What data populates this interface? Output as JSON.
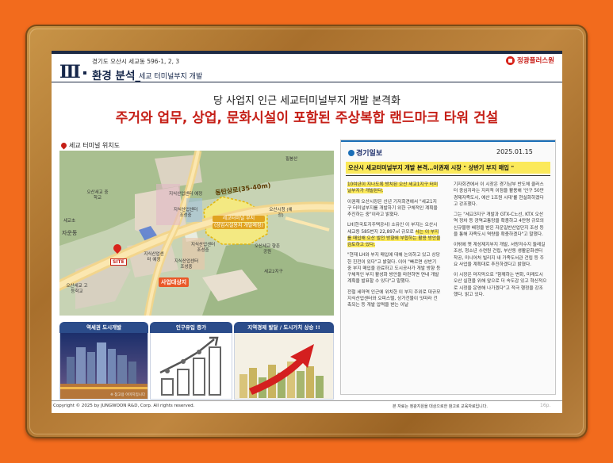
{
  "header": {
    "section_number": "Ⅲ",
    "subtitle": "경기도 오산시 세교동 596-1, 2, 3",
    "title_main": "환경 분석_",
    "title_sub": "세교 터미널부지 개발",
    "brand": "정광플러스원",
    "colors": {
      "navy": "#16274a",
      "red": "#c51f17",
      "frame": "#a86f2c",
      "background": "#f26b1d"
    }
  },
  "headline": {
    "line1": "당 사업지 인근 세교터미널부지 개발 본격화",
    "line2": "주거와 업무, 상업, 문화시설이 포함된 주상복합 랜드마크 타워 건설"
  },
  "map": {
    "label": "세교 터미널 위치도",
    "road_label": "동탄상로(35-40m)",
    "site_label": "SITE",
    "business_label": "사업대상지",
    "terminal_label_1": "세교터미널 부지",
    "terminal_label_2": "(상업시설용지 개발예정)",
    "place_labels": [
      "지식산업센터 예정",
      "지식산업센터 조성중",
      "지식산업센터 조성중",
      "지식산업센터 조성중",
      "지식산업센터 예정",
      "자운동",
      "오산세교 중학교",
      "세교초",
      "오산세교 고등학교",
      "오산시청 (예정)",
      "오산세교 향촌공원",
      "세교2지구",
      "필봉산"
    ]
  },
  "panels": [
    {
      "title": "역세권 도시개발",
      "caption": "※ 참고용 이미지입니다"
    },
    {
      "title": "인구유입 증가"
    },
    {
      "title": "지역경제 발달 / 도시가치 상승 !!"
    }
  ],
  "article": {
    "source": "경기일보",
    "date": "2025.01.15",
    "headline": "오산시 세교터미널부지 개발 본격…이권재 시장 \" 상반기 부지 매입 \"",
    "left_col": [
      {
        "text": "10여년이 지나도록 방치된 오산 세교1지구 터미널부지가 개발된다.",
        "highlight": true
      },
      {
        "text": "이권재 오산시장은 신년 기자회견에서 \"세교1지구 터미널부지를 개발하기 위한 구체적인 계획을 추진하는 중\"이라고 밝혔다.",
        "highlight": false
      },
      {
        "text_plain": "LH(한국토지주택공사) 소유인 이 부지는 오산시 세교동 585번지 22,897㎡ 규모로 ",
        "text_hl": "사는 이 부지를 매입해 오산 발전 방향에 부합하는 활용 방안을 검토하고 있다.",
        "highlight": "partial"
      },
      {
        "text": "\"현재 LH와 부지 매입에 대해 논의하고 있고 상당한 진전이 있다\"고 밝혔다. 이어 \"빠르면 상반기 중 부지 매입을 완료하고 도시공사가 개발 방향 등 구체적인 부지 활성화 방안을 마련하면 연내 개발계획을 발표할 수 있다\"고 말했다.",
        "highlight": false
      },
      {
        "text": "전철 세마역 인근에 위치한 이 부지 주위로 대규모 지식산업센터와 오피스텔, 상가건물이 잇따라 건축되는 등 개발 압력을 받는 이날",
        "highlight": false
      }
    ],
    "right_col": [
      "기자회견에서 이 시장은 경기남부 반도체 클러스터 중심지라는 지리적 이점을 활용해 '인구 50만 경제자족도시, 예산 1조원 시대'를 현실화하겠다고 강조했다.",
      "그는 \"세교3지구 개발과 GTX-C노선, KTX 오산역 정차 등 광역교통망을 확충하고 4만명 규모의 신규물량 배정을 받은 자운일반산업단지 조성 등을 통해 자족도시 역량을 확충하겠다\"고 말했다.",
      "이밖에 옛 계성제지부지 개발, 서랑저수지 둘레길 조성, 청소년 수련원 건립, 부산동 생활문화센터 착공, 미니어처 빌리지 내 가족도서관 건립 등 주요 사업을 계획대로 추진하겠다고 밝혔다.",
      "이 시장은 마지막으로 \"함께하는 변화, 미래도시 오산 실현을 위해 앞으로 더 속도감 있고 혁신적으로 시정을 운영해 나가겠다\"고 적극 행정을 강조했다. 밝고 있다."
    ]
  },
  "footer": {
    "copyright": "Copyright © 2025 by JUNGWOON R&D, Corp. All rights reserved.",
    "note": "본 자료는 정광지원을 대상으로한 참고로 교육자료입니다.",
    "page": "16p."
  }
}
